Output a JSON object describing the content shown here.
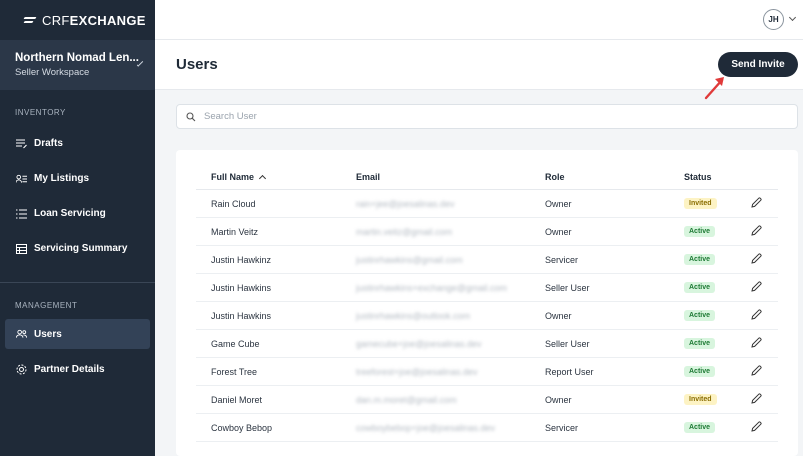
{
  "brand": {
    "logo_light": "CRF",
    "logo_bold": "EXCHANGE"
  },
  "workspace": {
    "name": "Northern Nomad Len...",
    "subtitle": "Seller Workspace"
  },
  "sidebar": {
    "inventory_label": "INVENTORY",
    "inventory_items": [
      {
        "label": "Drafts",
        "icon": "drafts-icon"
      },
      {
        "label": "My Listings",
        "icon": "listings-icon"
      },
      {
        "label": "Loan Servicing",
        "icon": "list-icon"
      },
      {
        "label": "Servicing Summary",
        "icon": "summary-icon"
      }
    ],
    "management_label": "MANAGEMENT",
    "management_items": [
      {
        "label": "Users",
        "icon": "users-icon",
        "active": true
      },
      {
        "label": "Partner Details",
        "icon": "gear-icon"
      }
    ]
  },
  "topbar": {
    "avatar_initials": "JH"
  },
  "header": {
    "title": "Users",
    "send_invite_label": "Send Invite"
  },
  "search": {
    "placeholder": "Search User",
    "value": ""
  },
  "table": {
    "columns": [
      "Full Name",
      "Email",
      "Role",
      "Status"
    ],
    "rows": [
      {
        "name": "Rain Cloud",
        "email": "rain+jee@joesalinas.dev",
        "role": "Owner",
        "status": "Invited"
      },
      {
        "name": "Martin Veitz",
        "email": "martin.veitz@gmail.com",
        "role": "Owner",
        "status": "Active"
      },
      {
        "name": "Justin Hawkinz",
        "email": "justinrhawkins@gmail.com",
        "role": "Servicer",
        "status": "Active"
      },
      {
        "name": "Justin Hawkins",
        "email": "justinrhawkins+exchange@gmail.com",
        "role": "Seller User",
        "status": "Active"
      },
      {
        "name": "Justin Hawkins",
        "email": "justinrhawkins@outlook.com",
        "role": "Owner",
        "status": "Active"
      },
      {
        "name": "Game Cube",
        "email": "gamecube+joe@joesalinas.dev",
        "role": "Seller User",
        "status": "Active"
      },
      {
        "name": "Forest Tree",
        "email": "treeforest+joe@joesalinas.dev",
        "role": "Report User",
        "status": "Active"
      },
      {
        "name": "Daniel Moret",
        "email": "dan.m.moret@gmail.com",
        "role": "Owner",
        "status": "Invited"
      },
      {
        "name": "Cowboy Bebop",
        "email": "cowboybebop+joe@joesalinas.dev",
        "role": "Servicer",
        "status": "Active"
      }
    ]
  },
  "colors": {
    "sidebar": "#1f2a38",
    "accent_arrow": "#e03a3a",
    "invited": "#fdf3c4",
    "active": "#d8f5de"
  }
}
